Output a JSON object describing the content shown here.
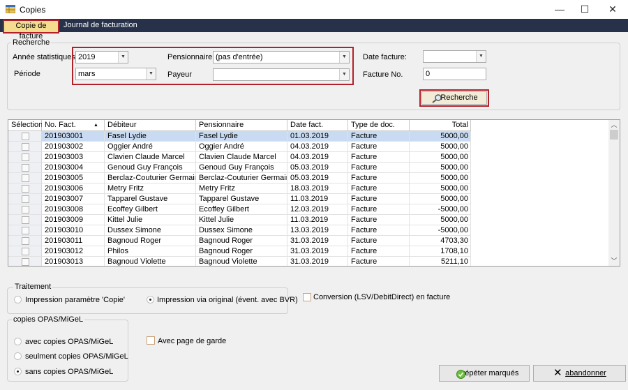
{
  "window": {
    "title": "Copies",
    "minimize_glyph": "—",
    "maximize_glyph": "☐",
    "close_glyph": "✕"
  },
  "tabs": [
    {
      "label": "Copie de facture"
    },
    {
      "label": "Journal de facturation"
    }
  ],
  "search": {
    "group_label": "Recherche",
    "annee_label": "Année statistiques",
    "annee_value": "2019",
    "periode_label": "Période",
    "periode_value": "mars",
    "pensionnaire_label": "Pensionnaire",
    "pensionnaire_value": "(pas d'entrée)",
    "payeur_label": "Payeur",
    "payeur_value": "",
    "date_facture_label": "Date facture:",
    "date_facture_value": "",
    "facture_no_label": "Facture No.",
    "facture_no_value": "0",
    "search_button": "Recherche"
  },
  "grid": {
    "columns": [
      "Sélection",
      "No. Fact.",
      "Débiteur",
      "Pensionnaire",
      "Date fact.",
      "Type de doc.",
      "Total"
    ],
    "sort_glyph": "▲",
    "rows": [
      [
        "201903001",
        "Fasel Lydie",
        "Fasel Lydie",
        "01.03.2019",
        "Facture",
        "5000,00"
      ],
      [
        "201903002",
        "Oggier André",
        "Oggier André",
        "04.03.2019",
        "Facture",
        "5000,00"
      ],
      [
        "201903003",
        "Clavien Claude Marcel",
        "Clavien Claude Marcel",
        "04.03.2019",
        "Facture",
        "5000,00"
      ],
      [
        "201903004",
        "Genoud Guy François",
        "Genoud Guy François",
        "05.03.2019",
        "Facture",
        "5000,00"
      ],
      [
        "201903005",
        "Berclaz-Couturier Germaine ...",
        "Berclaz-Couturier Germaine ...",
        "05.03.2019",
        "Facture",
        "5000,00"
      ],
      [
        "201903006",
        "Metry Fritz",
        "Metry Fritz",
        "18.03.2019",
        "Facture",
        "5000,00"
      ],
      [
        "201903007",
        "Tapparel Gustave",
        "Tapparel Gustave",
        "11.03.2019",
        "Facture",
        "5000,00"
      ],
      [
        "201903008",
        "Ecoffey Gilbert",
        "Ecoffey Gilbert",
        "12.03.2019",
        "Facture",
        "-5000,00"
      ],
      [
        "201903009",
        "Kittel Julie",
        "Kittel Julie",
        "11.03.2019",
        "Facture",
        "5000,00"
      ],
      [
        "201903010",
        "Dussex Simone",
        "Dussex Simone",
        "13.03.2019",
        "Facture",
        "-5000,00"
      ],
      [
        "201903011",
        "Bagnoud Roger",
        "Bagnoud Roger",
        "31.03.2019",
        "Facture",
        "4703,30"
      ],
      [
        "201903012",
        "Philos",
        "Bagnoud Roger",
        "31.03.2019",
        "Facture",
        "1708,10"
      ],
      [
        "201903013",
        "Bagnoud Violette",
        "Bagnoud Violette",
        "31.03.2019",
        "Facture",
        "5211,10"
      ]
    ]
  },
  "traitement": {
    "group_label": "Traitement",
    "option_copie": "Impression paramètre 'Copie'",
    "option_original": "Impression via original (évent. avec BVR)",
    "conversion_label": "Conversion (LSV/DebitDirect) en facture"
  },
  "opas": {
    "group_label": "copies OPAS/MiGeL",
    "option_avec": "avec copies OPAS/MiGeL",
    "option_seulement": "seulment copies OPAS/MiGeL",
    "option_sans": "sans copies OPAS/MiGeL",
    "page_garde_label": "Avec page de garde"
  },
  "buttons": {
    "repeat": "répéter marqués",
    "cancel": "abandonner"
  },
  "colors": {
    "accent_red": "#b3202a",
    "tab_active_bg": "#f5dc8f",
    "tab_strip_bg": "#27324a",
    "selected_row": "#c9dbf2"
  },
  "icons": {
    "app": "table-icon",
    "search": "magnifier-icon",
    "repeat": "green-check-icon",
    "cancel": "x-icon"
  }
}
